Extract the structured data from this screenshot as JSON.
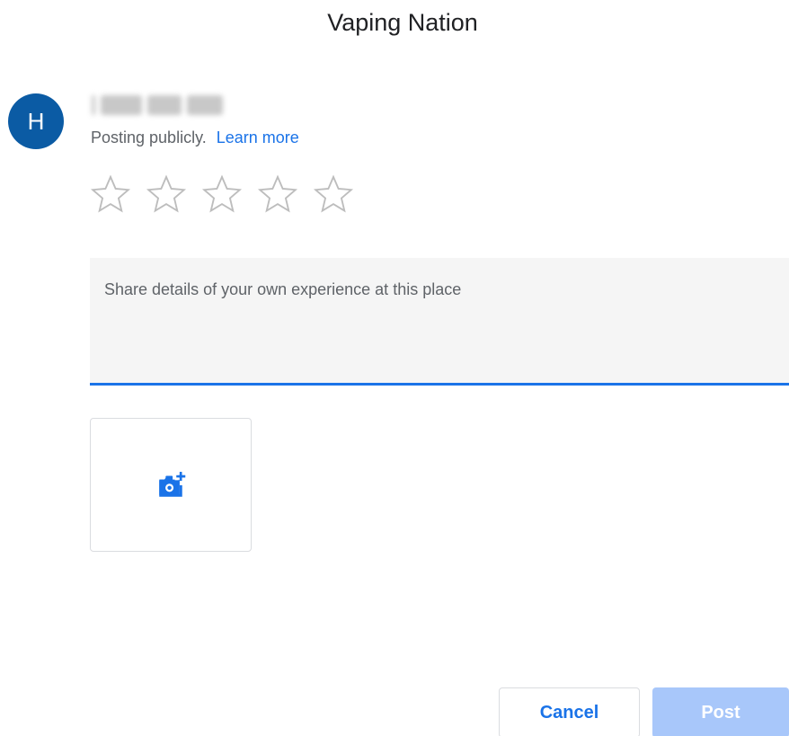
{
  "dialog": {
    "title": "Vaping Nation"
  },
  "user": {
    "avatar_initial": "H",
    "posting_text": "Posting publicly.",
    "learn_more_label": "Learn more"
  },
  "rating": {
    "value": 0,
    "max": 5,
    "star_icon": "star-outline-icon"
  },
  "review": {
    "placeholder": "Share details of your own experience at this place",
    "value": ""
  },
  "photo": {
    "icon": "add-photo-icon"
  },
  "actions": {
    "cancel_label": "Cancel",
    "post_label": "Post"
  },
  "colors": {
    "accent": "#1a73e8",
    "avatar": "#0b5ba4",
    "post_disabled": "#a8c7fa"
  }
}
